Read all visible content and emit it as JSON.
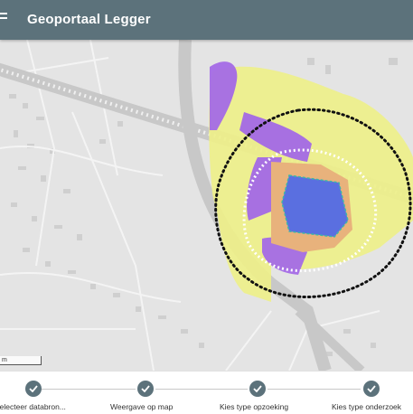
{
  "header": {
    "title": "Geoportaal Legger",
    "menu_icon": "hamburger-menu-icon",
    "background_color": "#5c727b"
  },
  "map": {
    "scale_label": "m",
    "colors": {
      "background": "#e4e4e4",
      "yellow_zone": "#eef08a",
      "purple_zone": "#a46ae6",
      "orange_zone": "#e8b27c",
      "blue_zone": "#5a6fe0",
      "teal_outline": "#3bb7a8",
      "black_dotted_boundary": "#111111",
      "white_dotted_boundary": "#ffffff"
    }
  },
  "stepper": {
    "accent_color": "#5c727b",
    "steps": [
      {
        "label": "Selecteer databron...",
        "status": "complete",
        "icon": "check-icon"
      },
      {
        "label": "Weergave op map",
        "status": "complete",
        "icon": "check-icon"
      },
      {
        "label": "Kies type opzoeking",
        "status": "complete",
        "icon": "check-icon"
      },
      {
        "label": "Kies type onderzoek",
        "status": "complete",
        "icon": "check-icon"
      }
    ]
  }
}
